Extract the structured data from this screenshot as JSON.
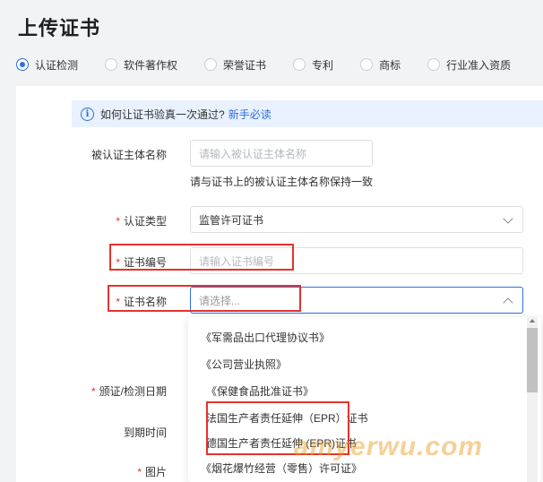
{
  "page": {
    "title": "上传证书"
  },
  "cert_types": [
    {
      "label": "认证检测",
      "checked": true
    },
    {
      "label": "软件著作权",
      "checked": false
    },
    {
      "label": "荣誉证书",
      "checked": false
    },
    {
      "label": "专利",
      "checked": false
    },
    {
      "label": "商标",
      "checked": false
    },
    {
      "label": "行业准入资质",
      "checked": false
    }
  ],
  "notice": {
    "icon": "info-icon",
    "icon_glyph": "i",
    "text": "如何让证书验真一次通过?",
    "link": "新手必读"
  },
  "form": {
    "subject_name": {
      "label": "被认证主体名称",
      "placeholder": "请输入被认证主体名称",
      "hint": "请与证书上的被认证主体名称保持一致"
    },
    "cert_category": {
      "label": "认证类型",
      "value": "监管许可证书"
    },
    "cert_number": {
      "label": "证书编号",
      "placeholder": "请输入证书编号"
    },
    "cert_name": {
      "label": "证书名称",
      "placeholder": "请选择..."
    },
    "issue_date": {
      "label": "颁证/检测日期"
    },
    "expiry": {
      "label": "到期时间"
    },
    "image": {
      "label": "图片"
    },
    "required_mark": "*"
  },
  "dropdown": {
    "options": [
      "《军需品出口代理协议书》",
      "《公司营业执照》",
      "《保健食品批准证书》",
      "法国生产者责任延伸（EPR）证书",
      "德国生产者责任延伸 (EPR)证书",
      "《烟花爆竹经营（零售）许可证》"
    ]
  },
  "watermark": "amyerwu.com",
  "colors": {
    "accent": "#2f6fe0",
    "highlight": "#e5322d"
  }
}
